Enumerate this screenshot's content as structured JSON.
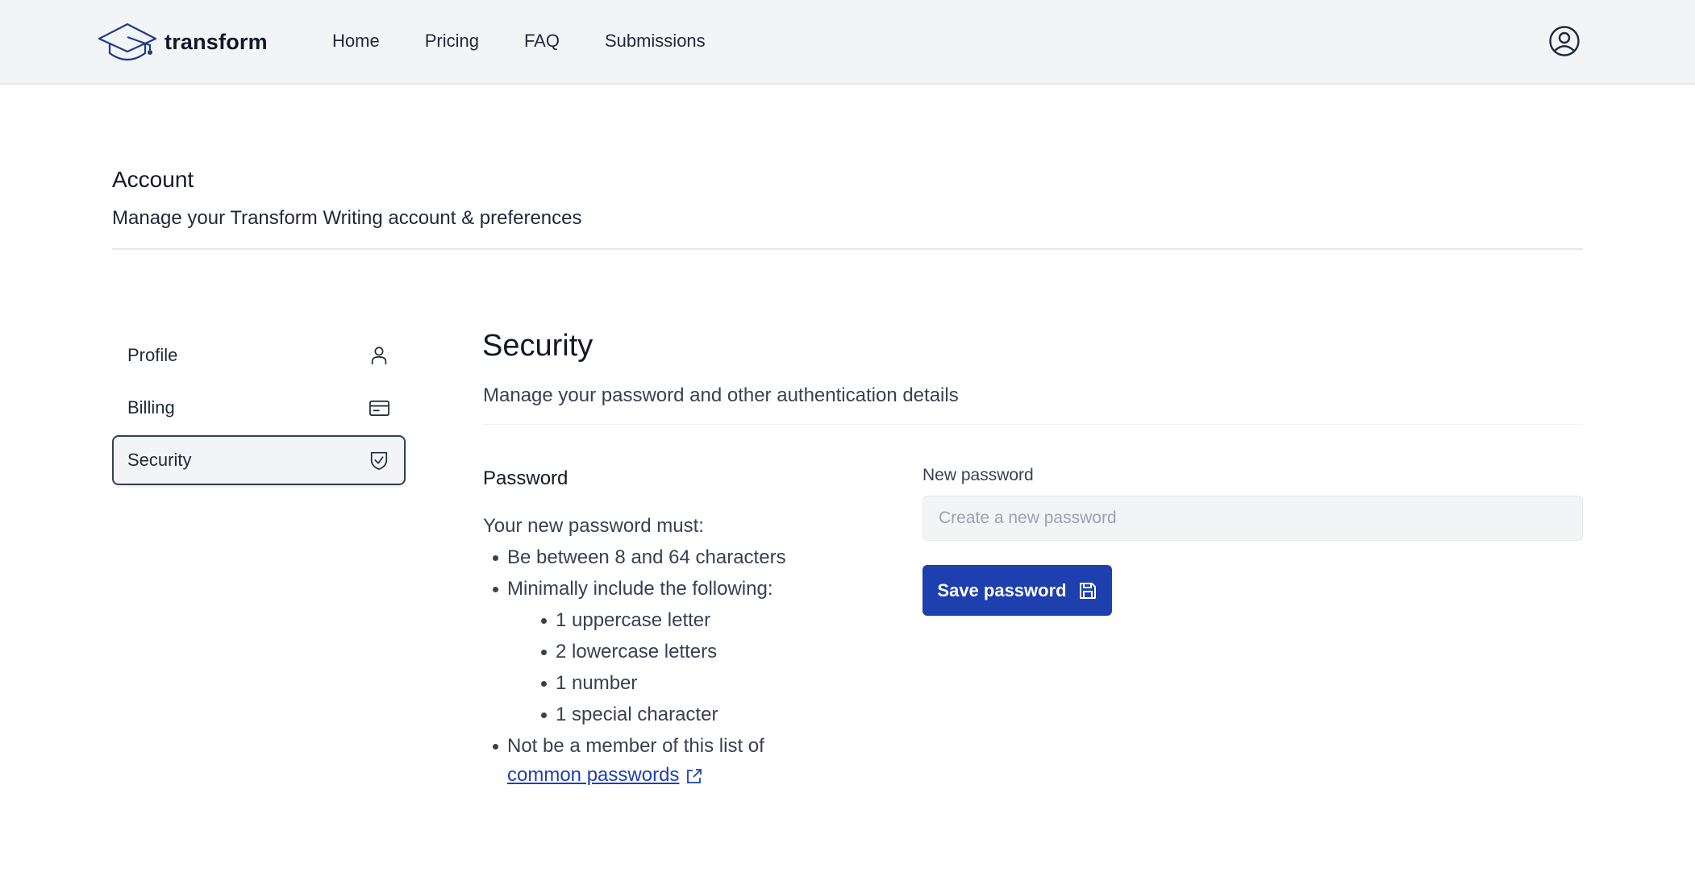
{
  "header": {
    "brand": "transform",
    "nav": [
      "Home",
      "Pricing",
      "FAQ",
      "Submissions"
    ]
  },
  "account": {
    "title": "Account",
    "subtitle": "Manage your Transform Writing account & preferences"
  },
  "sidebar": {
    "items": [
      {
        "label": "Profile",
        "icon": "user-icon"
      },
      {
        "label": "Billing",
        "icon": "credit-card-icon"
      },
      {
        "label": "Security",
        "icon": "shield-check-icon",
        "active": true
      }
    ]
  },
  "security": {
    "title": "Security",
    "subtitle": "Manage your password and other authentication details",
    "password_heading": "Password",
    "rules_intro": "Your new password must:",
    "rule_length": "Be between 8 and 64 characters",
    "rule_include": "Minimally include the following:",
    "include": [
      "1 uppercase letter",
      "2 lowercase letters",
      "1 number",
      "1 special character"
    ],
    "rule_common": "Not be a member of this list of",
    "common_link": "common passwords",
    "new_password_label": "New password",
    "new_password_placeholder": "Create a new password",
    "new_password_value": "",
    "save_label": "Save password"
  },
  "colors": {
    "brand_blue": "#1e3fae",
    "link_blue": "#1e40af",
    "header_bg": "#f3f4f6"
  }
}
